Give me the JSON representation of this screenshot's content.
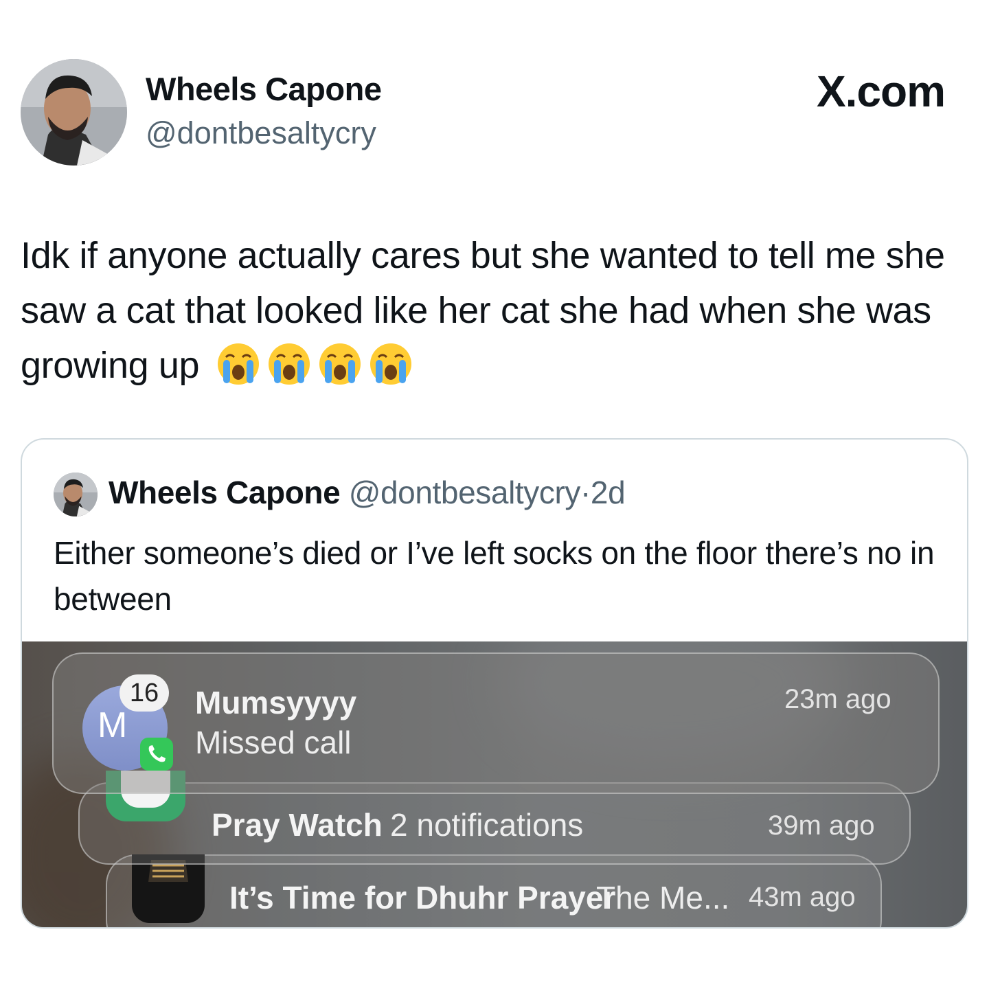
{
  "site": "X.com",
  "author": {
    "name": "Wheels Capone",
    "handle": "@dontbesaltycry"
  },
  "tweet": {
    "text": "Idk if anyone actually cares but she wanted to tell me she saw a cat that looked like her cat she had when she was growing up",
    "emojis": [
      "crying-face",
      "crying-face",
      "crying-face",
      "crying-face"
    ]
  },
  "quoted": {
    "name": "Wheels Capone",
    "handle": "@dontbesaltycry",
    "separator": "·",
    "time": "2d",
    "text": "Either someone’s died or I’ve left socks on the floor there’s no in between",
    "screenshot": {
      "notifications": [
        {
          "initial": "M",
          "count": "16",
          "title": "Mumsyyyy",
          "body": "Missed call",
          "time": "23m ago",
          "icon": "phone-icon"
        },
        {
          "title": "Pray Watch",
          "body": "2 notifications",
          "time": "39m ago",
          "icon": "pray-watch-app-icon"
        },
        {
          "title": "It’s Time for Dhuhr Prayer",
          "body": "The Me...",
          "time": "43m ago",
          "icon": "kaaba-app-icon"
        }
      ]
    }
  }
}
